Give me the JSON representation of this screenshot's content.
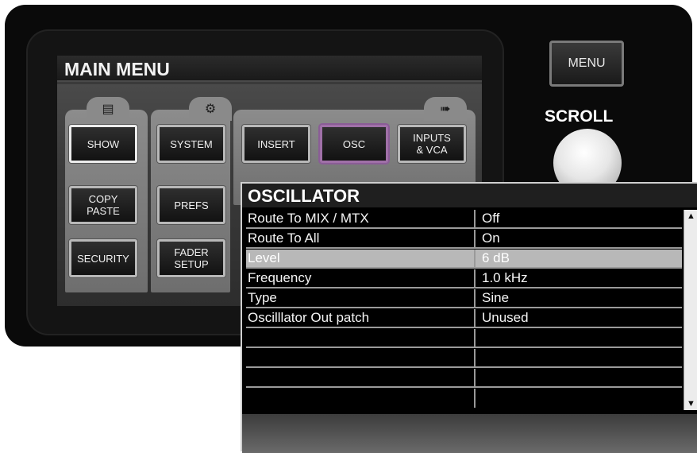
{
  "main_menu": {
    "title": "MAIN MENU",
    "tabs": [
      {
        "icon": "list-icon",
        "glyph": "▤"
      },
      {
        "icon": "gears-icon",
        "glyph": "⚙"
      },
      {
        "icon": "signal-patch-icon",
        "glyph": "➠"
      }
    ],
    "buttons": {
      "show": "SHOW",
      "copy_paste": "COPY\nPASTE",
      "security": "SECURITY",
      "system": "SYSTEM",
      "prefs": "PREFS",
      "fader_setup": "FADER\nSETUP",
      "insert": "INSERT",
      "osc": "OSC",
      "inputs_vca": "INPUTS\n& VCA"
    }
  },
  "hardware": {
    "menu_label": "MENU",
    "scroll_label": "SCROLL"
  },
  "oscillator": {
    "title": "OSCILLATOR",
    "selected_row": 2,
    "rows": [
      {
        "label": "Route To MIX / MTX",
        "value": "Off"
      },
      {
        "label": "Route To All",
        "value": "On"
      },
      {
        "label": "Level",
        "value": "6 dB"
      },
      {
        "label": "Frequency",
        "value": "1.0 kHz"
      },
      {
        "label": "Type",
        "value": "Sine"
      },
      {
        "label": "Oscilllator Out patch",
        "value": "Unused"
      },
      {
        "label": "",
        "value": ""
      },
      {
        "label": "",
        "value": ""
      },
      {
        "label": "",
        "value": ""
      },
      {
        "label": "",
        "value": ""
      }
    ]
  },
  "colors": {
    "active_outline": "#a070a8",
    "selected_row": "#b8b8b8"
  }
}
